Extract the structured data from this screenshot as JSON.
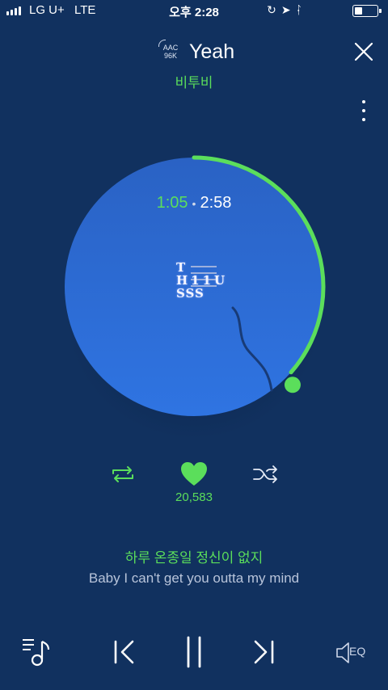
{
  "status_bar": {
    "carrier": "LG U+",
    "network": "LTE",
    "time": "오후 2:28",
    "icons": [
      "orientation-lock-icon",
      "location-icon",
      "bluetooth-icon",
      "battery-icon"
    ]
  },
  "header": {
    "codec_line1": "AAC",
    "codec_line2": "96K",
    "song_title": "Yeah",
    "artist": "비투비"
  },
  "player": {
    "current_time": "1:05",
    "total_time": "2:58",
    "progress_fraction": 0.365,
    "like_count": "20,583"
  },
  "album_logo": {
    "line1": "T",
    "line2": "H11U",
    "line3": "SSS"
  },
  "lyrics": {
    "current": "하루 온종일 정신이 없지",
    "translation": "Baby I can't get you outta my mind"
  },
  "controls": {
    "eq_label": "EQ"
  },
  "colors": {
    "background": "#11315f",
    "accent": "#5bde5b",
    "disc": "#2f74e2"
  }
}
